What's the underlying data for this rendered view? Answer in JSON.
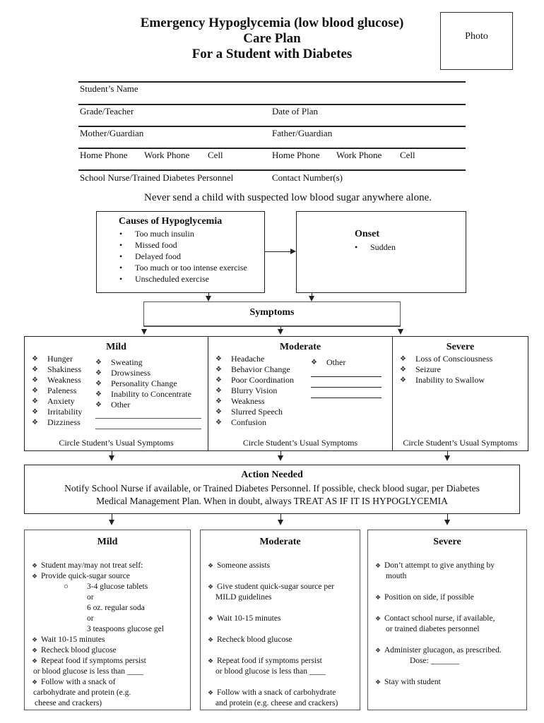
{
  "header": {
    "title_lines": [
      "Emergency Hypoglycemia (low blood glucose)",
      "Care Plan",
      "For a Student with Diabetes"
    ],
    "photo_label": "Photo"
  },
  "info_fields": {
    "student_name": "Student’s Name",
    "grade_teacher": "Grade/Teacher",
    "date_of_plan": "Date of Plan",
    "mother_guardian": "Mother/Guardian",
    "father_guardian": "Father/Guardian",
    "mother_phones": [
      "Home Phone",
      "Work Phone",
      "Cell"
    ],
    "father_phones": [
      "Home Phone",
      "Work Phone",
      "Cell"
    ],
    "school_nurse": "School Nurse/Trained Diabetes Personnel",
    "contact_numbers": "Contact Number(s)"
  },
  "warning": "Never send a child with suspected low blood sugar anywhere alone.",
  "causes": {
    "title": "Causes of Hypoglycemia",
    "items": [
      "Too much insulin",
      "Missed food",
      "Delayed food",
      "Too much or too intense exercise",
      "Unscheduled exercise"
    ]
  },
  "onset": {
    "title": "Onset",
    "items": [
      "Sudden"
    ]
  },
  "symptoms": {
    "title": "Symptoms",
    "mild": {
      "title": "Mild",
      "col1": [
        "Hunger",
        "Shakiness",
        "Weakness",
        "Paleness",
        "Anxiety",
        "Irritability",
        "Dizziness"
      ],
      "col2": [
        "Sweating",
        "Drowsiness",
        "Personality Change",
        "Inability to Concentrate",
        "Other"
      ],
      "note": "Circle Student’s Usual Symptoms"
    },
    "moderate": {
      "title": "Moderate",
      "col1": [
        "Headache",
        "Behavior Change",
        "Poor Coordination",
        "Blurry Vision",
        "Weakness",
        "Slurred Speech",
        "Confusion"
      ],
      "col2": [
        "Other"
      ],
      "note": "Circle Student’s Usual Symptoms"
    },
    "severe": {
      "title": "Severe",
      "col1": [
        "Loss of Consciousness",
        "Seizure",
        "Inability to Swallow"
      ],
      "note": "Circle Student’s Usual Symptoms"
    }
  },
  "action_needed": {
    "title": "Action Needed",
    "line1": "Notify School Nurse if available, or Trained Diabetes Personnel.  If possible, check blood sugar, per Diabetes",
    "line2": "Medical Management Plan.  When in doubt, always TREAT AS IF IT IS HYPOGLYCEMIA"
  },
  "treatment": {
    "mild": {
      "title": "Mild",
      "items_a": [
        "Student may/may not treat self:",
        "Provide quick-sugar source"
      ],
      "sources": [
        "3-4 glucose tablets",
        "or",
        "6 oz. regular soda",
        "or",
        "3 teaspoons glucose gel"
      ],
      "items_b": [
        "Wait 10-15 minutes",
        "Recheck blood glucose"
      ],
      "repeat_1": "Repeat food if symptoms persist",
      "repeat_2": "or blood glucose is less than ____",
      "follow_1": "Follow with a snack of",
      "follow_2": "carbohydrate and protein (e.g.",
      "follow_3": "cheese and crackers)"
    },
    "moderate": {
      "title": "Moderate",
      "items": [
        [
          "Someone assists"
        ],
        [
          "Give student quick-sugar source per",
          "MILD guidelines"
        ],
        [
          "Wait 10-15 minutes"
        ],
        [
          "Recheck blood glucose"
        ],
        [
          "Repeat food if symptoms persist",
          "or blood glucose is less than ____"
        ],
        [
          "Follow with a snack of  carbohydrate",
          "and protein (e.g. cheese and crackers)"
        ]
      ]
    },
    "severe": {
      "title": "Severe",
      "items": [
        [
          "Don’t attempt to give  anything by",
          "mouth"
        ],
        [
          "Position on side, if possible"
        ],
        [
          "Contact school nurse, if available,",
          "or trained diabetes personnel"
        ],
        [
          "Administer glucagon, as prescribed.",
          "Dose: _______"
        ],
        [
          "Stay with  student"
        ]
      ]
    }
  }
}
